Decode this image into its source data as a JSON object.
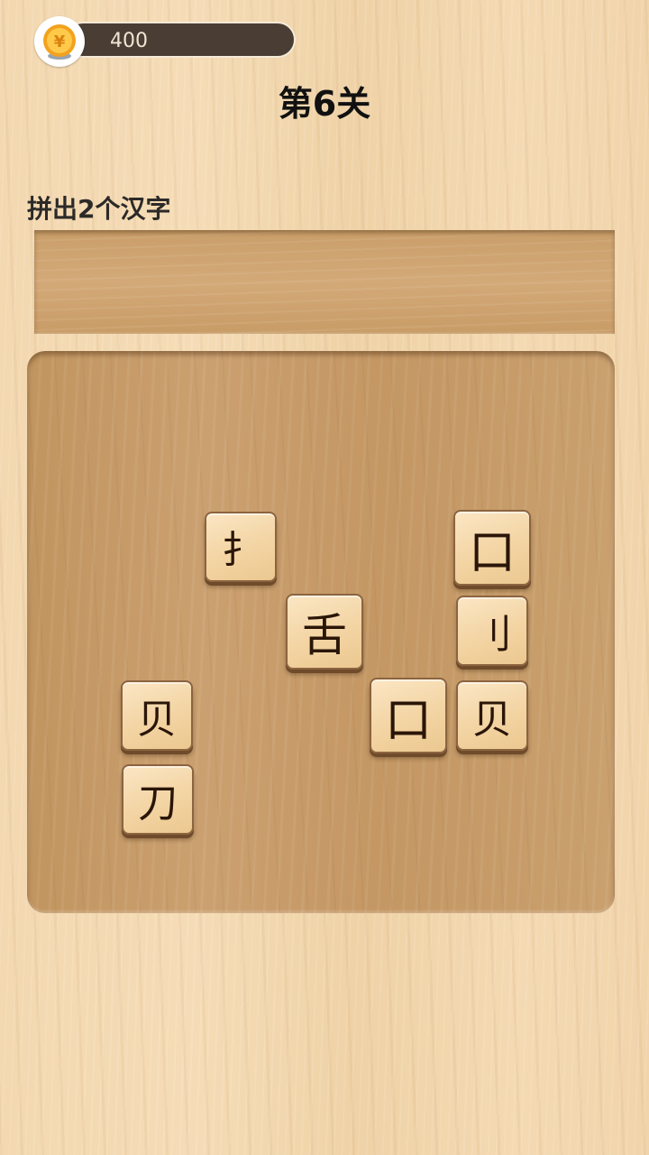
{
  "header": {
    "coins": "400",
    "coin_icon": "yuan-coin-icon",
    "coin_symbol": "¥",
    "level_title": "第6关"
  },
  "task": {
    "instruction": "拼出2个汉字"
  },
  "board": {
    "tiles": [
      {
        "char": "扌",
        "name": "tile-shou-radical"
      },
      {
        "char": "口",
        "name": "tile-kou-top-right"
      },
      {
        "char": "舌",
        "name": "tile-she"
      },
      {
        "char": "刂",
        "name": "tile-dao-radical"
      },
      {
        "char": "贝",
        "name": "tile-bei-left"
      },
      {
        "char": "口",
        "name": "tile-kou-center"
      },
      {
        "char": "贝",
        "name": "tile-bei-right"
      },
      {
        "char": "刀",
        "name": "tile-dao"
      }
    ]
  },
  "colors": {
    "tile_text": "#2a1608",
    "coin_track": "#4a3d33",
    "coin_gold": "#f5a623"
  }
}
